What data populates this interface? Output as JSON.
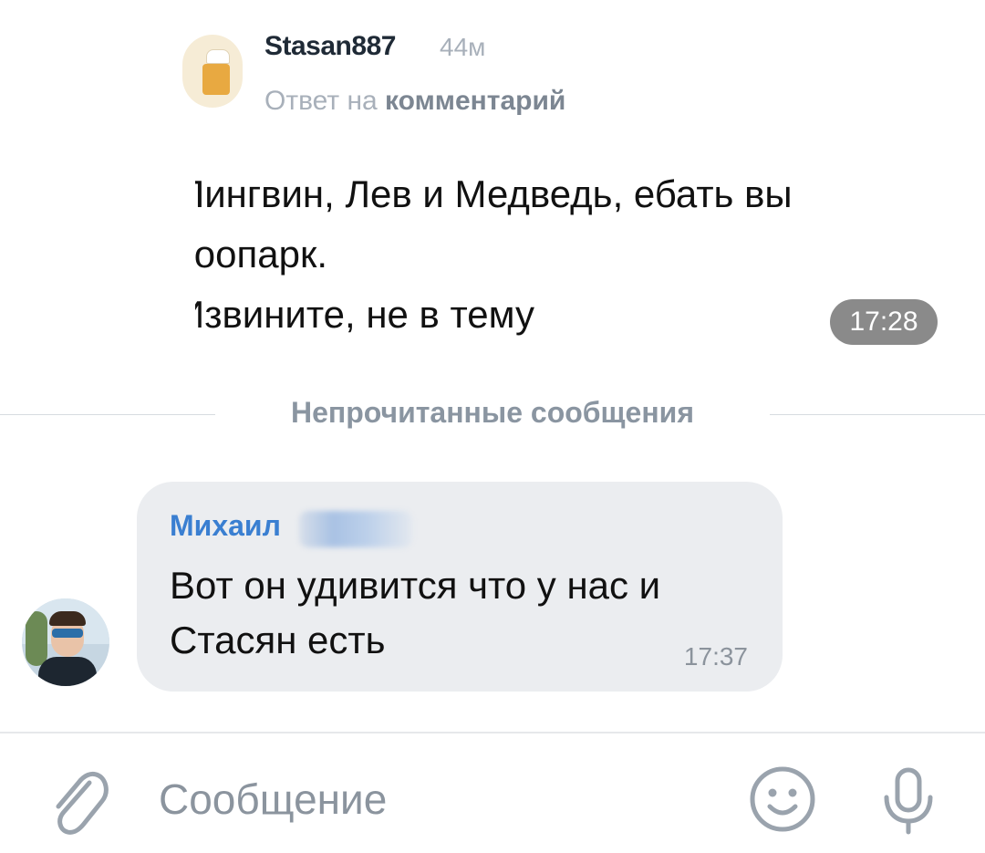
{
  "embedded_comment": {
    "author": "Stasan887",
    "time_ago": "44м",
    "reply_prefix": "Ответ на",
    "reply_target": "комментарий",
    "lines": [
      "Пингвин, Лев и Медведь, ебать вы",
      "зоопарк.",
      "Извините, не в тему"
    ],
    "timestamp": "17:28"
  },
  "divider": {
    "label": "Непрочитанные сообщения"
  },
  "incoming_message": {
    "sender": "Михаил",
    "text": "Вот он удивится что у нас и Стасян есть",
    "timestamp": "17:37"
  },
  "composer": {
    "placeholder": "Сообщение",
    "attach_icon": "paperclip-icon",
    "emoji_icon": "smiley-icon",
    "mic_icon": "microphone-icon"
  },
  "colors": {
    "sender_name": "#3a7fd1",
    "bubble_bg": "#ebedf0",
    "time_pill_bg": "#8a8a8a",
    "icon_gray": "#9aa3ad"
  }
}
